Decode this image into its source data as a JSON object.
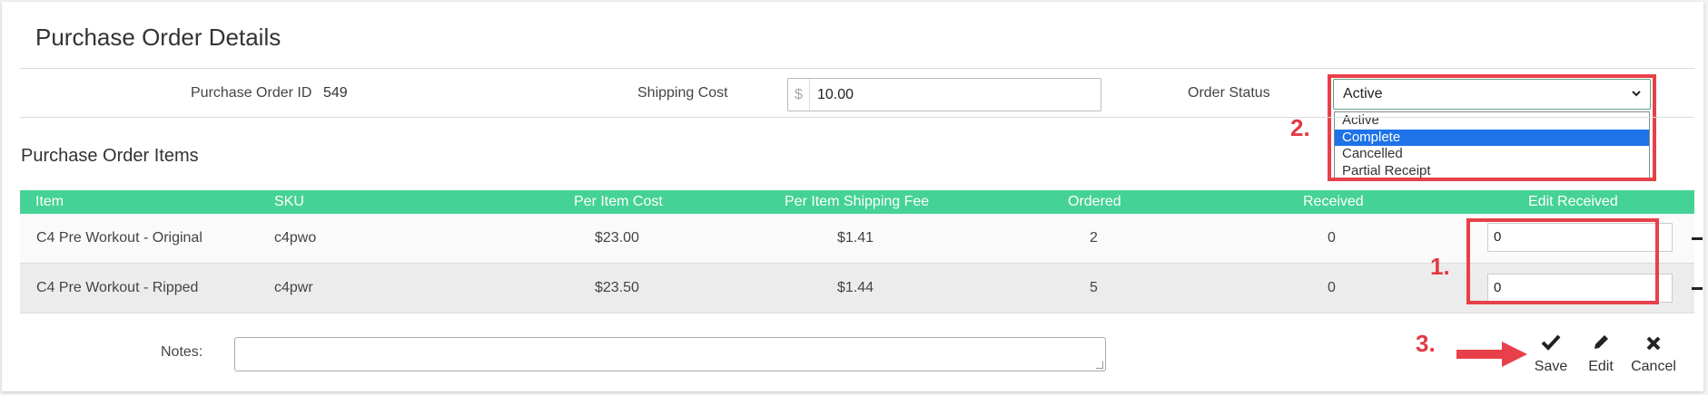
{
  "page": {
    "title": "Purchase Order Details"
  },
  "header_fields": {
    "po_id_label": "Purchase Order ID",
    "po_id_value": "549",
    "shipping_label": "Shipping Cost",
    "currency_symbol": "$",
    "shipping_value": "10.00",
    "status_label": "Order Status",
    "status_selected": "Active",
    "status_options": [
      "Active",
      "Complete",
      "Cancelled",
      "Partial Receipt"
    ],
    "status_highlighted": "Complete"
  },
  "items_section": {
    "title": "Purchase Order Items",
    "columns": [
      "Item",
      "SKU",
      "Per Item Cost",
      "Per Item Shipping Fee",
      "Ordered",
      "Received",
      "Edit Received"
    ],
    "rows": [
      {
        "item": "C4 Pre Workout - Original",
        "sku": "c4pwo",
        "cost": "$23.00",
        "ship_fee": "$1.41",
        "ordered": "2",
        "received": "0",
        "edit_received": "0"
      },
      {
        "item": "C4 Pre Workout - Ripped",
        "sku": "c4pwr",
        "cost": "$23.50",
        "ship_fee": "$1.44",
        "ordered": "5",
        "received": "0",
        "edit_received": "0"
      }
    ]
  },
  "notes": {
    "label": "Notes:",
    "value": ""
  },
  "actions": {
    "save": "Save",
    "edit": "Edit",
    "cancel": "Cancel"
  },
  "annotations": {
    "step1": "1.",
    "step2": "2.",
    "step3": "3."
  },
  "colors": {
    "header_green": "#45d296",
    "annotation_red": "#e8404a",
    "selected_blue": "#1e73e8"
  },
  "icons": {
    "save": "check-icon",
    "edit": "pencil-icon",
    "cancel": "close-icon",
    "remove": "minus-icon",
    "select": "chevron-down-icon"
  }
}
